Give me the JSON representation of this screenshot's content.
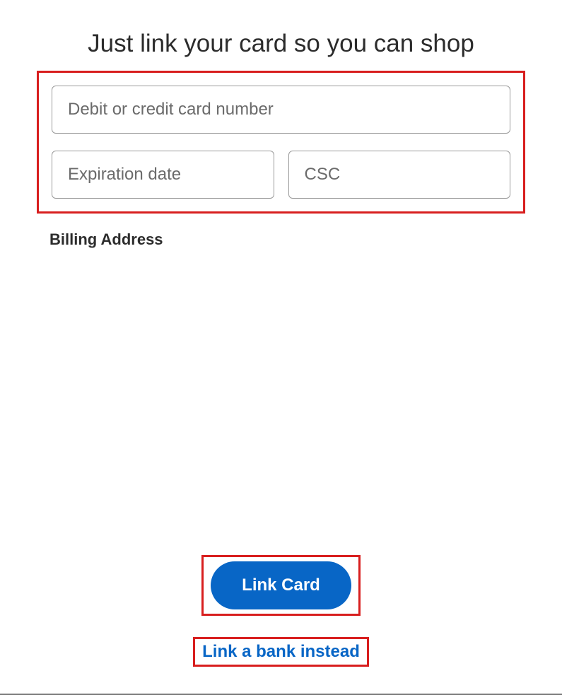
{
  "title": "Just link your card so you can shop",
  "form": {
    "card_number_placeholder": "Debit or credit card number",
    "expiration_placeholder": "Expiration date",
    "csc_placeholder": "CSC",
    "billing_label": "Billing Address"
  },
  "actions": {
    "link_card_label": "Link Card",
    "link_bank_label": "Link a bank instead"
  },
  "colors": {
    "highlight": "#d81e1e",
    "primary": "#0866c6"
  }
}
